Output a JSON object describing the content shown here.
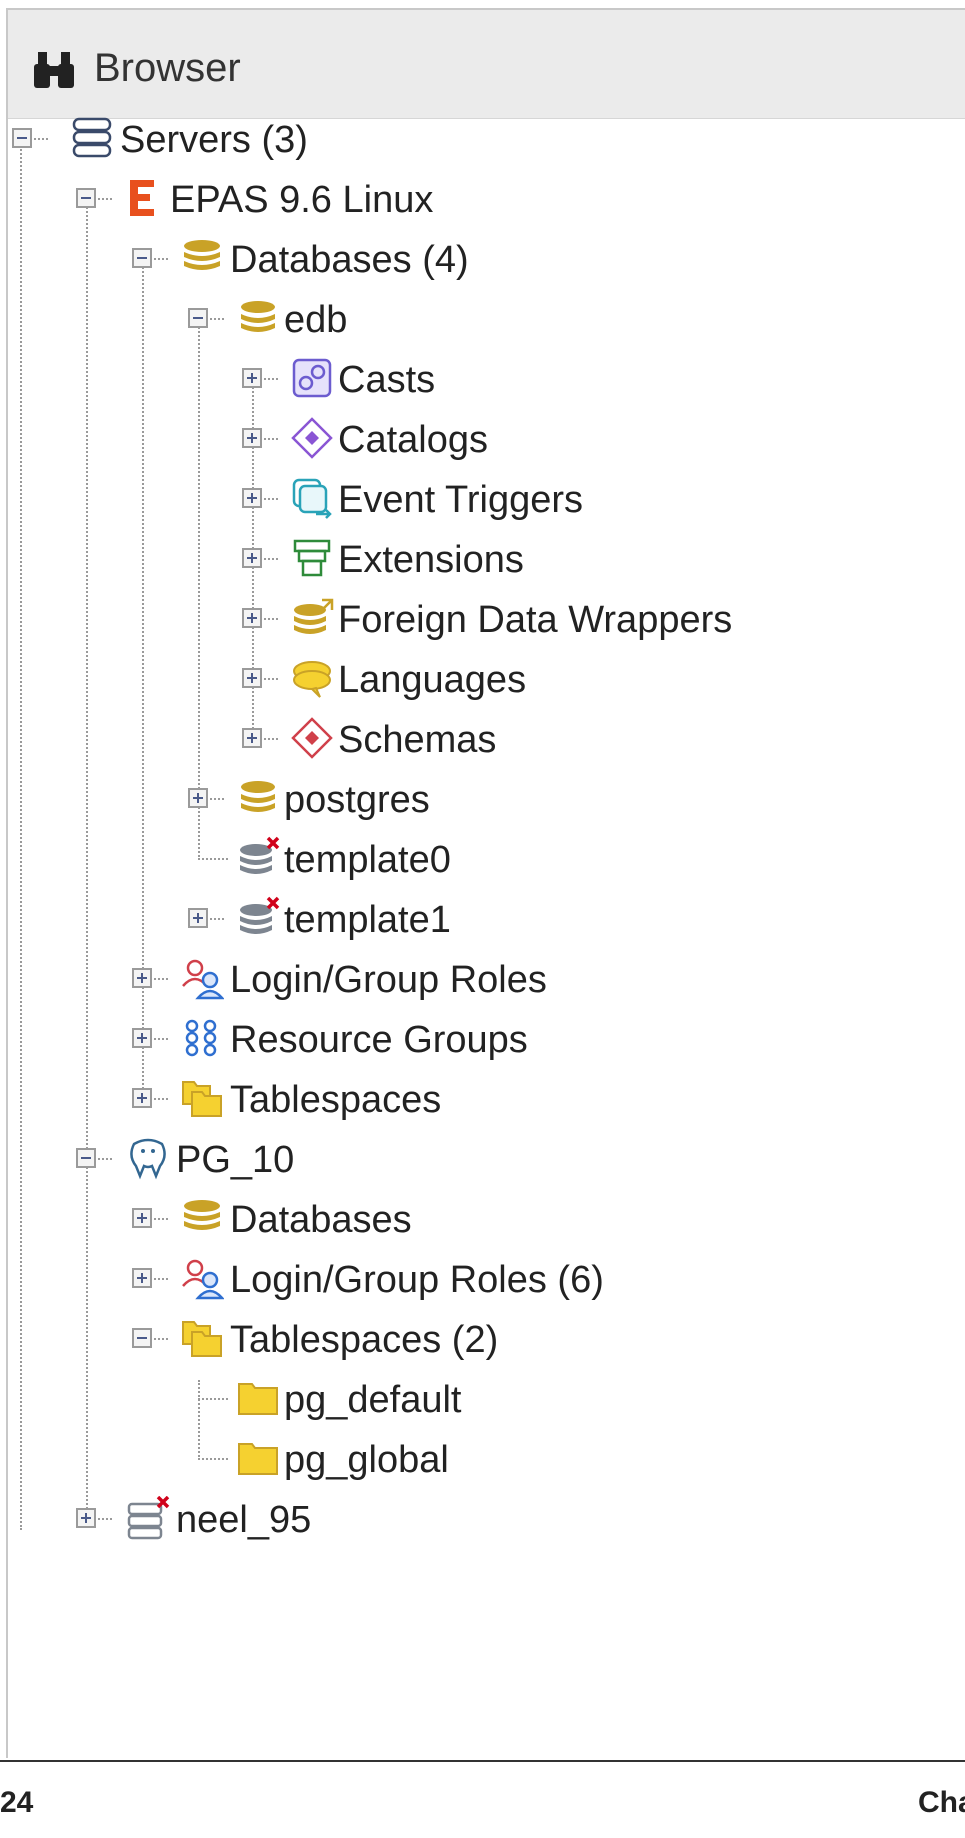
{
  "header": {
    "title": "Browser",
    "icon": "binoculars-icon"
  },
  "tree": {
    "servers": "Servers (3)",
    "epas": "EPAS 9.6 Linux",
    "epas_databases": "Databases (4)",
    "edb": "edb",
    "casts": "Casts",
    "catalogs": "Catalogs",
    "event_triggers": "Event Triggers",
    "extensions": "Extensions",
    "fdw": "Foreign Data Wrappers",
    "languages": "Languages",
    "schemas": "Schemas",
    "postgres": "postgres",
    "template0": "template0",
    "template1": "template1",
    "epas_roles": "Login/Group Roles",
    "resource_groups": "Resource Groups",
    "epas_tablespaces": "Tablespaces",
    "pg10": "PG_10",
    "pg10_databases": "Databases",
    "pg10_roles": "Login/Group Roles (6)",
    "pg10_tablespaces": "Tablespaces (2)",
    "pg_default": "pg_default",
    "pg_global": "pg_global",
    "neel": "neel_95"
  },
  "footer": {
    "page": "24",
    "chapter": "Cha"
  },
  "colors": {
    "db_gold": "#c9a227",
    "db_grey": "#7d8590",
    "red_x": "#d0021b",
    "epas_orange": "#e8501e"
  }
}
